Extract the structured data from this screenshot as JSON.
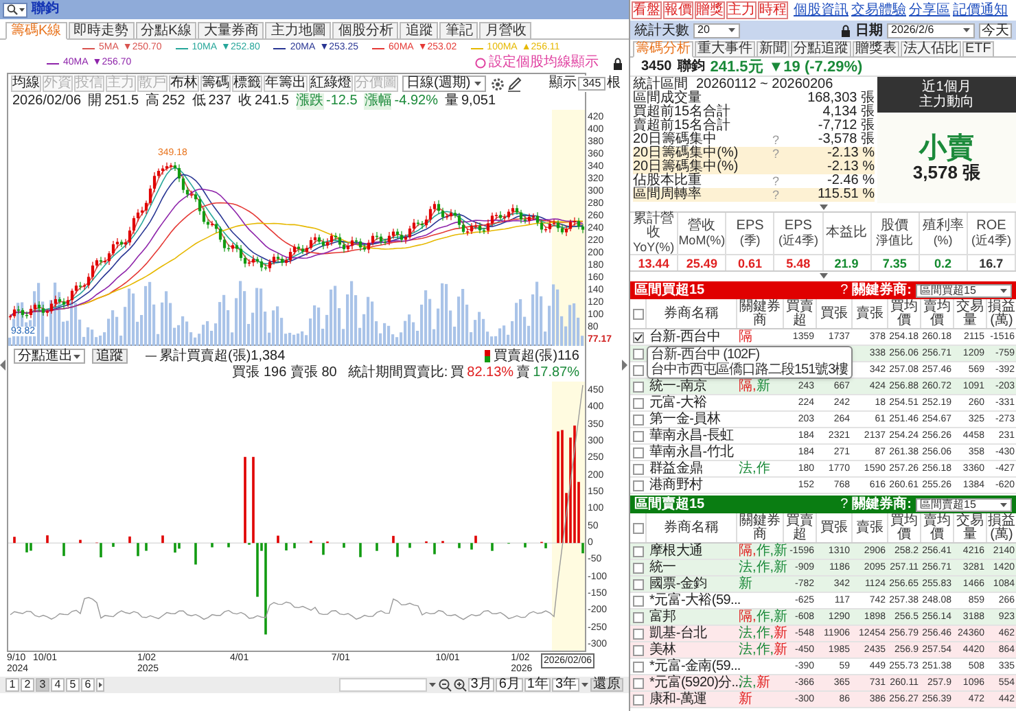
{
  "app_bar": {
    "title": "聯鈞"
  },
  "tabs": [
    {
      "label": "籌碼K線",
      "selected": true
    },
    {
      "label": "即時走勢",
      "selected": false
    },
    {
      "label": "分點K線",
      "selected": false
    },
    {
      "label": "大量券商",
      "selected": false
    },
    {
      "label": "主力地圖",
      "selected": false
    },
    {
      "label": "個股分析",
      "selected": false
    },
    {
      "label": "追蹤",
      "selected": false
    },
    {
      "label": "筆記",
      "selected": false
    },
    {
      "label": "月營收",
      "selected": false
    }
  ],
  "ma_legend": [
    {
      "label": "5MA",
      "value": "▼250.70",
      "color": "#d9534f"
    },
    {
      "label": "10MA",
      "value": "▼252.80",
      "color": "#26a69a"
    },
    {
      "label": "20MA",
      "value": "▼253.25",
      "color": "#283593"
    },
    {
      "label": "60MA",
      "value": "▼253.02",
      "color": "#e53935"
    },
    {
      "label": "100MA",
      "value": "▲256.11",
      "color": "#e6b800"
    },
    {
      "label": "40MA",
      "value": "▼256.70",
      "color": "#8e24aa"
    }
  ],
  "ma_setting": "設定個股均線顯示",
  "chart_toolbar": {
    "buttons": [
      {
        "label": "均線",
        "disabled": false
      },
      {
        "label": "外資",
        "disabled": true
      },
      {
        "label": "投信",
        "disabled": true
      },
      {
        "label": "主力",
        "disabled": true
      },
      {
        "label": "散戶",
        "disabled": true
      },
      {
        "label": "布林",
        "disabled": false
      },
      {
        "label": "籌碼",
        "disabled": false
      },
      {
        "label": "標籤",
        "disabled": false
      },
      {
        "label": "年籌出",
        "disabled": false
      },
      {
        "label": "紅綠燈",
        "disabled": false
      },
      {
        "label": "分價圖",
        "disabled": true
      }
    ],
    "period": "日線(週期)",
    "display_label": "顯示",
    "display_count": "345",
    "display_unit": "根"
  },
  "quote": {
    "date": "2026/02/06",
    "items": [
      {
        "label": "開",
        "value": "251.5",
        "kind": "price"
      },
      {
        "label": "高",
        "value": "252",
        "kind": "price"
      },
      {
        "label": "低",
        "value": "237",
        "kind": "price"
      },
      {
        "label": "收",
        "value": "241.5",
        "kind": "price"
      },
      {
        "label": "漲跌",
        "value": "-12.5",
        "kind": "change"
      },
      {
        "label": "漲幅",
        "value": "-4.92%",
        "kind": "change"
      },
      {
        "label": "量",
        "value": "9,051",
        "kind": "price"
      }
    ]
  },
  "price_annotations": {
    "high": "349.18",
    "low": "93.82"
  },
  "price_axis": [
    "420",
    "400",
    "380",
    "360",
    "340",
    "320",
    "300",
    "280",
    "260",
    "240",
    "220",
    "200",
    "180",
    "160",
    "140",
    "120",
    "100",
    "80"
  ],
  "axis_marker": "77.17",
  "lower_panel": {
    "selector": "分點進出",
    "button": "追蹤",
    "cumulative": "累計買賣超(張)1,384",
    "net": "買賣超(張)116",
    "buy_sell": "買張 196 賣張 80",
    "ratio": {
      "label": "統計期間買賣比:",
      "buy_label": "買",
      "buy_value": "82.13%",
      "sell_label": "賣",
      "sell_value": "17.87%"
    }
  },
  "lower_axis": [
    "450",
    "400",
    "350",
    "300",
    "250",
    "200",
    "150",
    "100",
    "50",
    "0",
    "-50",
    "-100",
    "-150",
    "-200",
    "-250",
    "-300"
  ],
  "x_axis": [
    {
      "label": "9/10",
      "year": "2024"
    },
    {
      "label": "10/01"
    },
    {
      "label": "1/02",
      "year": "2025"
    },
    {
      "label": "4/01"
    },
    {
      "label": "7/01"
    },
    {
      "label": "10/01"
    },
    {
      "label": "1/02",
      "year": "2026"
    }
  ],
  "x_axis_current": "2026/02/06",
  "bottom_bar": {
    "pages": [
      {
        "label": "1",
        "selected": false
      },
      {
        "label": "2",
        "selected": false
      },
      {
        "label": "3",
        "selected": true
      },
      {
        "label": "4",
        "selected": false
      },
      {
        "label": "5",
        "selected": false
      },
      {
        "label": "6",
        "selected": false
      }
    ],
    "ranges": [
      "3月",
      "6月",
      "1年",
      "3年"
    ],
    "restore": "還原"
  },
  "right": {
    "quick_buttons": [
      "看盤",
      "報價",
      "贈獎",
      "主力",
      "時程"
    ],
    "links": [
      "個股資訊",
      "交易體驗",
      "分享區",
      "記價通知"
    ],
    "stat_days": {
      "label": "統計天數",
      "value": "20"
    },
    "date": {
      "label": "日期",
      "value": "2026/2/6",
      "today": "今天"
    },
    "tabs": [
      {
        "label": "籌碼分析",
        "selected": true
      },
      {
        "label": "重大事件",
        "selected": false
      },
      {
        "label": "新聞",
        "selected": false
      },
      {
        "label": "分點追蹤",
        "selected": false
      },
      {
        "label": "贈獎表",
        "selected": false
      },
      {
        "label": "法人佔比",
        "selected": false
      },
      {
        "label": "ETF",
        "selected": false
      }
    ],
    "stock": {
      "code": "3450",
      "name": "聯鈞",
      "price": "241.5元",
      "change": "▼19 (-7.29%)"
    },
    "stats": [
      {
        "kind": "range",
        "label": "統計區間",
        "value": "20260112 ~ 20260206",
        "highlight": false
      },
      {
        "kind": "metric",
        "label": "區間成交量",
        "value": "168,303 張",
        "highlight": false
      },
      {
        "kind": "metric",
        "label": "買超前15名合計",
        "value": "4,134 張",
        "highlight": false
      },
      {
        "kind": "metric",
        "label": "賣超前15名合計",
        "value": "-7,712 張",
        "highlight": false
      },
      {
        "kind": "metric",
        "label": "20日籌碼集中",
        "help": "?",
        "value": "-3,578 張",
        "highlight": false
      },
      {
        "kind": "metric",
        "label": "20日籌碼集中(%)",
        "help": "?",
        "value": "-2.13 %",
        "highlight": true
      },
      {
        "kind": "metric",
        "label": "20日籌碼集中(%)",
        "value": "-2.13 %",
        "highlight": true
      },
      {
        "kind": "metric",
        "label": "佔股本比重",
        "help": "?",
        "value": "-2.46 %",
        "highlight": false
      },
      {
        "kind": "metric",
        "label": "區間周轉率",
        "help": "?",
        "value": "115.51 %",
        "highlight": true
      }
    ],
    "trend": {
      "title": "近1個月",
      "subtitle": "主力動向",
      "verdict": "小賣",
      "amount": "3,578 張"
    },
    "fundamentals": [
      {
        "label": "累計營收",
        "sub": "YoY(%)",
        "value": "13.44",
        "color": "#e02020"
      },
      {
        "label": "營收",
        "sub": "MoM(%)",
        "value": "25.49",
        "color": "#e02020"
      },
      {
        "label": "EPS",
        "sub": "(季)",
        "value": "0.61",
        "color": "#e02020"
      },
      {
        "label": "EPS",
        "sub": "(近4季)",
        "value": "5.48",
        "color": "#e02020"
      },
      {
        "label": "本益比",
        "value": "21.9",
        "color": "#138a2e"
      },
      {
        "label": "股價",
        "sub": "淨值比",
        "value": "7.35",
        "color": "#138a2e"
      },
      {
        "label": "殖利率",
        "sub": "(%)",
        "value": "0.2",
        "color": "#138a2e"
      },
      {
        "label": "ROE",
        "sub": "(近4季)",
        "value": "16.7",
        "color": "#333333"
      }
    ],
    "tables": [
      {
        "kind": "buy",
        "title": "區間買超15",
        "help": "?",
        "filter_label": "關鍵券商:",
        "filter_value": "區間買超15",
        "select_all": false,
        "columns": [
          "券商名稱",
          "關鍵券商",
          "買賣超",
          "買張",
          "賣張",
          "買均價",
          "賣均價",
          "交易量",
          "損益(萬)"
        ],
        "rows": [
          {
            "checked": true,
            "name": "台新-西台中",
            "tags": [
              {
                "label": "隔",
                "color": "#e02020"
              }
            ],
            "net": "1359",
            "buy": "1737",
            "sell": "378",
            "buy_avg": "254.18",
            "sell_avg": "260.18",
            "volume": "2115",
            "pnl": "-1516"
          },
          {
            "checked": false,
            "sell": "338",
            "buy_avg": "256.06",
            "sell_avg": "256.71",
            "volume": "1209",
            "pnl": "-759",
            "color": "#e6f4e6"
          },
          {
            "checked": false,
            "sell": "342",
            "buy_avg": "257.08",
            "sell_avg": "257.46",
            "volume": "569",
            "pnl": "-392"
          },
          {
            "checked": false,
            "name": "統一-南京",
            "tags": [
              {
                "label": "隔,",
                "color": "#e02020"
              },
              {
                "label": "新",
                "color": "#1b8a3a"
              }
            ],
            "net": "243",
            "buy": "667",
            "sell": "424",
            "buy_avg": "256.88",
            "sell_avg": "260.72",
            "volume": "1091",
            "pnl": "-203",
            "color": "#e6f4e6"
          },
          {
            "checked": false,
            "name": "元富-大裕",
            "net": "224",
            "buy": "242",
            "sell": "18",
            "buy_avg": "254.51",
            "sell_avg": "252.19",
            "volume": "260",
            "pnl": "-331"
          },
          {
            "checked": false,
            "name": "第一金-員林",
            "net": "203",
            "buy": "264",
            "sell": "61",
            "buy_avg": "251.46",
            "sell_avg": "254.67",
            "volume": "325",
            "pnl": "-273"
          },
          {
            "checked": false,
            "name": "華南永昌-長虹",
            "net": "184",
            "buy": "2321",
            "sell": "2137",
            "buy_avg": "254.24",
            "sell_avg": "256.26",
            "volume": "4458",
            "pnl": "231"
          },
          {
            "checked": false,
            "name": "華南永昌-竹北",
            "net": "184",
            "buy": "271",
            "sell": "87",
            "buy_avg": "261.38",
            "sell_avg": "256.06",
            "volume": "358",
            "pnl": "-430"
          },
          {
            "checked": false,
            "name": "群益金鼎",
            "tags": [
              {
                "label": "法,",
                "color": "#1b8a3a"
              },
              {
                "label": "作",
                "color": "#1b8a3a"
              }
            ],
            "net": "180",
            "buy": "1770",
            "sell": "1590",
            "buy_avg": "257.26",
            "sell_avg": "256.18",
            "volume": "3360",
            "pnl": "-427"
          },
          {
            "checked": false,
            "name": "港商野村",
            "net": "152",
            "buy": "768",
            "sell": "616",
            "buy_avg": "260.61",
            "sell_avg": "255.26",
            "volume": "1384",
            "pnl": "-620"
          }
        ]
      },
      {
        "kind": "sell",
        "title": "區間賣超15",
        "help": "?",
        "filter_label": "關鍵券商:",
        "filter_value": "區間賣超15",
        "select_all": false,
        "columns": [
          "券商名稱",
          "關鍵券商",
          "買賣超",
          "買張",
          "賣張",
          "買均價",
          "賣均價",
          "交易量",
          "損益(萬)"
        ],
        "rows": [
          {
            "checked": false,
            "name": "摩根大通",
            "tags": [
              {
                "label": "隔,",
                "color": "#e02020"
              },
              {
                "label": "作,",
                "color": "#1b8a3a"
              },
              {
                "label": "新",
                "color": "#1b8a3a"
              }
            ],
            "net": "-1596",
            "buy": "1310",
            "sell": "2906",
            "buy_avg": "258.2",
            "sell_avg": "256.41",
            "volume": "4216",
            "pnl": "2140",
            "color": "#e6f4e6"
          },
          {
            "checked": false,
            "name": "統一",
            "tags": [
              {
                "label": "法,",
                "color": "#1b8a3a"
              },
              {
                "label": "作,",
                "color": "#1b8a3a"
              },
              {
                "label": "新",
                "color": "#1b8a3a"
              }
            ],
            "net": "-909",
            "buy": "1186",
            "sell": "2095",
            "buy_avg": "257.11",
            "sell_avg": "256.71",
            "volume": "3281",
            "pnl": "1420",
            "color": "#e6f4e6"
          },
          {
            "checked": false,
            "name": "國票-金鈞",
            "tags": [
              {
                "label": "新",
                "color": "#1b8a3a"
              }
            ],
            "net": "-782",
            "buy": "342",
            "sell": "1124",
            "buy_avg": "256.65",
            "sell_avg": "255.83",
            "volume": "1466",
            "pnl": "1084",
            "color": "#e6f4e6"
          },
          {
            "checked": false,
            "name": "*元富-大裕(59...",
            "net": "-625",
            "buy": "117",
            "sell": "742",
            "buy_avg": "257.38",
            "sell_avg": "248.08",
            "volume": "859",
            "pnl": "266"
          },
          {
            "checked": false,
            "name": "富邦",
            "tags": [
              {
                "label": "隔,",
                "color": "#e02020"
              },
              {
                "label": "作,",
                "color": "#1b8a3a"
              },
              {
                "label": "新",
                "color": "#1b8a3a"
              }
            ],
            "net": "-608",
            "buy": "1290",
            "sell": "1898",
            "buy_avg": "256.5",
            "sell_avg": "256.14",
            "volume": "3188",
            "pnl": "923",
            "color": "#e6f4e6"
          },
          {
            "checked": false,
            "name": "凱基-台北",
            "tags": [
              {
                "label": "法,",
                "color": "#1b8a3a"
              },
              {
                "label": "作,",
                "color": "#1b8a3a"
              },
              {
                "label": "新",
                "color": "#e02020"
              }
            ],
            "net": "-548",
            "buy": "11906",
            "sell": "12454",
            "buy_avg": "256.79",
            "sell_avg": "256.46",
            "volume": "24360",
            "pnl": "462",
            "color": "#fde8ea"
          },
          {
            "checked": false,
            "name": "美林",
            "tags": [
              {
                "label": "法,",
                "color": "#1b8a3a"
              },
              {
                "label": "作,",
                "color": "#1b8a3a"
              },
              {
                "label": "新",
                "color": "#e02020"
              }
            ],
            "net": "-450",
            "buy": "1985",
            "sell": "2435",
            "buy_avg": "256.9",
            "sell_avg": "257.54",
            "volume": "4420",
            "pnl": "864",
            "color": "#fde8ea"
          },
          {
            "checked": false,
            "name": "*元富-金南(59...",
            "net": "-390",
            "buy": "59",
            "sell": "449",
            "buy_avg": "255.73",
            "sell_avg": "251.38",
            "volume": "508",
            "pnl": "335"
          },
          {
            "checked": false,
            "name": "*元富(5920)分...",
            "tags": [
              {
                "label": "法,",
                "color": "#1b8a3a"
              },
              {
                "label": "新",
                "color": "#e02020"
              }
            ],
            "net": "-366",
            "buy": "365",
            "sell": "731",
            "buy_avg": "260.11",
            "sell_avg": "257.9",
            "volume": "1096",
            "pnl": "554",
            "color": "#fde8ea"
          },
          {
            "checked": false,
            "name": "康和-萬運",
            "tags": [
              {
                "label": "新",
                "color": "#e02020"
              }
            ],
            "net": "-300",
            "buy": "86",
            "sell": "386",
            "buy_avg": "256.27",
            "sell_avg": "256.39",
            "volume": "472",
            "pnl": "442",
            "color": "#fde8ea"
          }
        ]
      }
    ],
    "tooltip": {
      "title": "台新-西台中 (102F)",
      "address": "台中市西屯區僑口路二段151號3樓"
    }
  }
}
